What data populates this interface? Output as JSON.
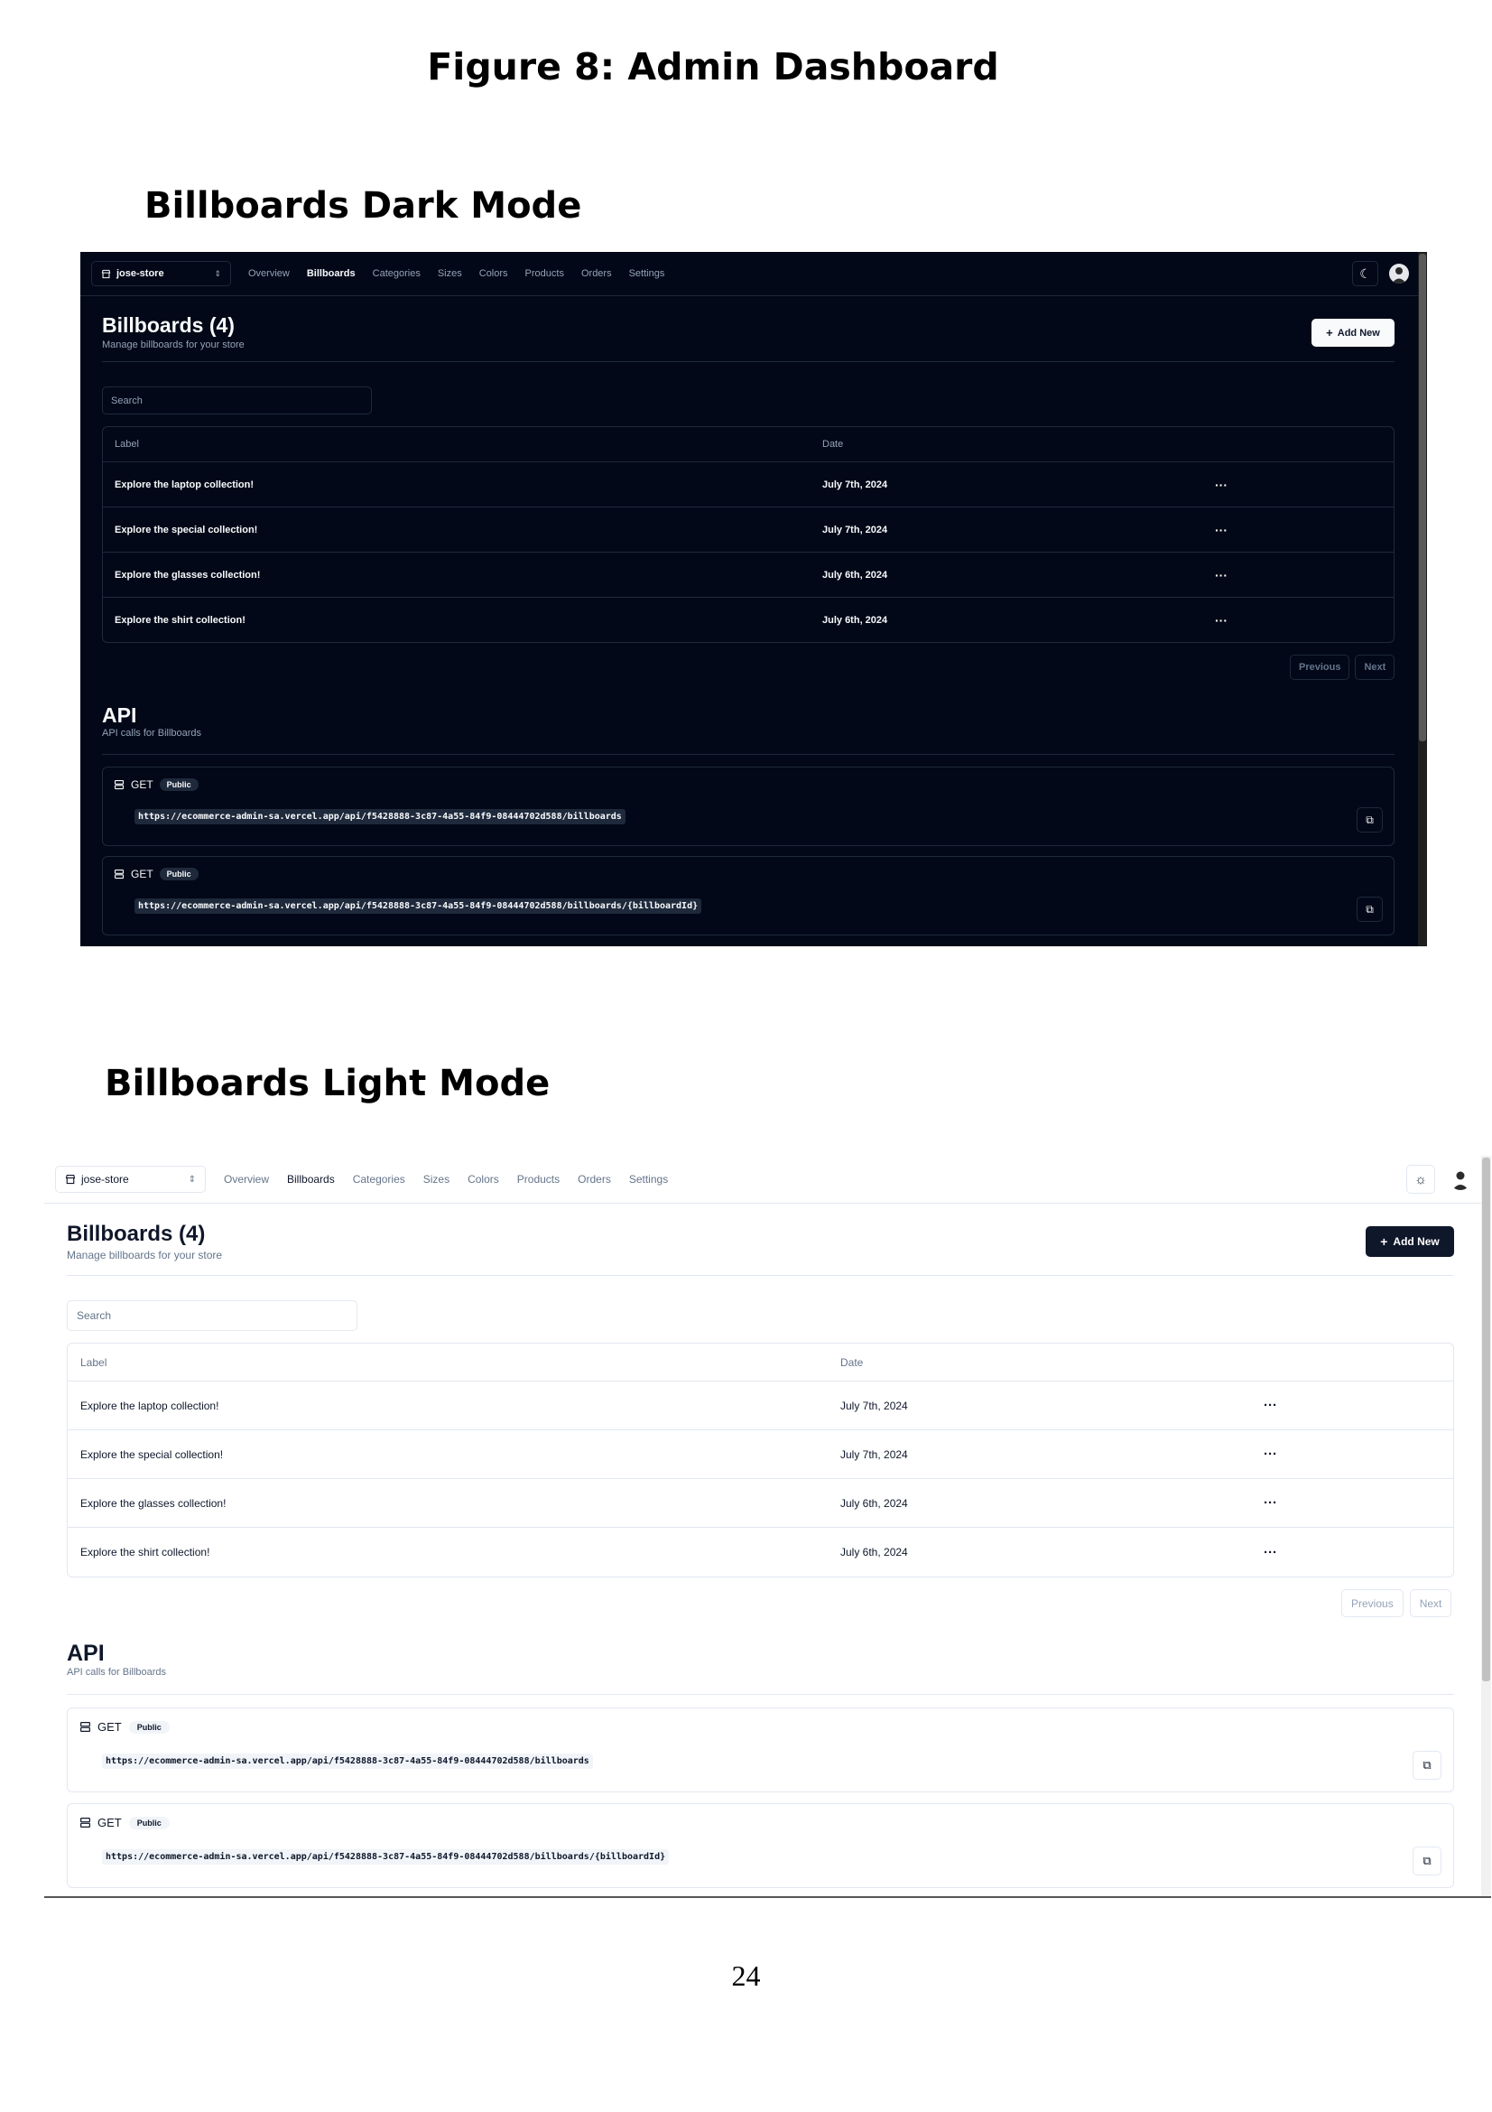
{
  "doc": {
    "figure_title": "Figure 8: Admin Dashboard",
    "dark_section_title": "Billboards Dark Mode",
    "light_section_title": "Billboards Light Mode",
    "page_number": "24"
  },
  "nav": {
    "store_name": "jose-store",
    "links": [
      "Overview",
      "Billboards",
      "Categories",
      "Sizes",
      "Colors",
      "Products",
      "Orders",
      "Settings"
    ],
    "active_link": "Billboards"
  },
  "billboards": {
    "title": "Billboards (4)",
    "subtitle": "Manage billboards for your store",
    "add_new_label": "Add New",
    "search_placeholder": "Search",
    "columns": [
      "Label",
      "Date"
    ],
    "rows": [
      {
        "label": "Explore the laptop collection!",
        "date": "July 7th, 2024",
        "actions": "···"
      },
      {
        "label": "Explore the special collection!",
        "date": "July 7th, 2024",
        "actions": "···"
      },
      {
        "label": "Explore the glasses collection!",
        "date": "July 6th, 2024",
        "actions": "···"
      },
      {
        "label": "Explore the shirt collection!",
        "date": "July 6th, 2024",
        "actions": "···"
      }
    ],
    "previous_label": "Previous",
    "next_label": "Next"
  },
  "api": {
    "title": "API",
    "subtitle": "API calls for Billboards",
    "endpoints": [
      {
        "method": "GET",
        "access": "Public",
        "url": "https://ecommerce-admin-sa.vercel.app/api/f5428888-3c87-4a55-84f9-08444702d588/billboards"
      },
      {
        "method": "GET",
        "access": "Public",
        "url": "https://ecommerce-admin-sa.vercel.app/api/f5428888-3c87-4a55-84f9-08444702d588/billboards/{billboardId}"
      }
    ]
  },
  "icons": {
    "store": "store-icon",
    "switcher": "chevron-up-down-icon",
    "dark_theme_toggle": "moon-icon",
    "light_theme_toggle": "sun-icon",
    "add": "plus-icon",
    "server": "server-icon",
    "copy": "copy-icon",
    "more": "more-horizontal-icon"
  },
  "colors": {
    "dark_background": "#020817",
    "dark_border": "#1e293b",
    "light_primary_button": "#0f172a",
    "muted_text": "#64748b"
  }
}
